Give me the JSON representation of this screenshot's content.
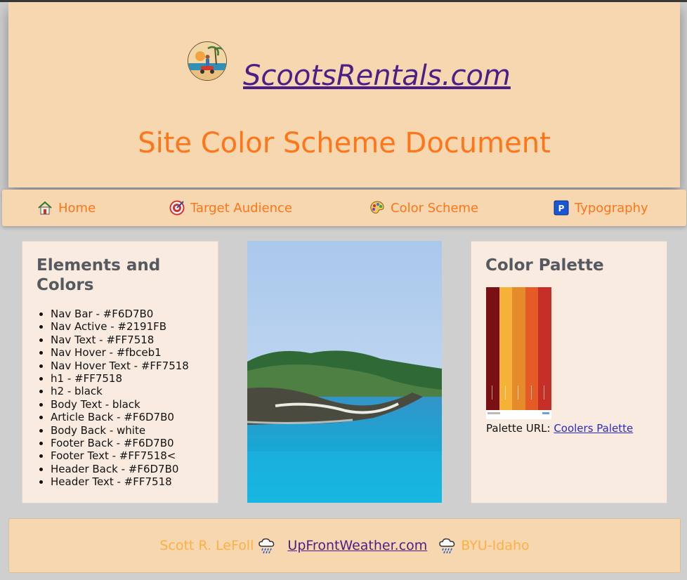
{
  "header": {
    "site_link": "ScootsRentals.com",
    "title": "Site Color Scheme Document",
    "logo_icon": "scooter-beach-logo"
  },
  "nav": {
    "items": [
      {
        "label": "Home",
        "icon": "house-icon"
      },
      {
        "label": "Target Audience",
        "icon": "target-icon"
      },
      {
        "label": "Color Scheme",
        "icon": "palette-icon"
      },
      {
        "label": "Typography",
        "icon": "p-icon"
      }
    ]
  },
  "elements_card": {
    "heading": "Elements and Colors",
    "items": [
      "Nav Bar - #F6D7B0",
      "Nav Active - #2191FB",
      "Nav Text - #FF7518",
      "Nav Hover - #fbceb1",
      "Nav Hover Text - #FF7518",
      "h1 - #FF7518",
      "h2 - black",
      "Body Text - black",
      "Article Back - #F6D7B0",
      "Body Back - white",
      "Footer Back - #F6D7B0",
      "Footer Text - #FF7518<",
      "Header Back - #F6D7B0",
      "Header Text - #FF7518"
    ]
  },
  "palette_card": {
    "heading": "Color Palette",
    "colors": [
      "#7a1013",
      "#f4b237",
      "#e48b2a",
      "#e55b26",
      "#c62f28"
    ],
    "url_label": "Palette URL:",
    "url_link": "Coolers Palette"
  },
  "footer": {
    "name": "Scott R. LeFoll",
    "link": "UpFrontWeather.com",
    "school": "BYU-Idaho",
    "icon": "rain-cloud-icon"
  },
  "colors": {
    "header_back": "#F6D7B0",
    "nav_text": "#FF7518",
    "article_back": "#FAEBE0",
    "page_back": "#cfcfcf"
  }
}
